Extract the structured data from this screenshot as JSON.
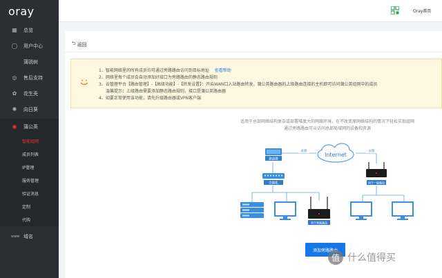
{
  "app": {
    "logo": "oray"
  },
  "topbar": {
    "home_link": "Oray首页"
  },
  "sidebar": {
    "items": [
      {
        "label": "总览",
        "icon": "grid-icon"
      },
      {
        "label": "用户中心",
        "icon": "user-icon"
      },
      {
        "label": "蒲锐树",
        "icon": ""
      },
      {
        "label": "售后支持",
        "icon": "support-icon"
      },
      {
        "label": "花生壳",
        "icon": "peanut-icon"
      },
      {
        "label": "向日葵",
        "icon": "sunflower-icon"
      },
      {
        "label": "蒲公英",
        "icon": "dandelion-icon"
      }
    ],
    "sub_items": [
      {
        "label": "智能组网",
        "active": true
      },
      {
        "label": "成员列表"
      },
      {
        "label": "IP管理"
      },
      {
        "label": "服务管理"
      },
      {
        "label": "验证消息"
      },
      {
        "label": "定制"
      },
      {
        "label": "代购"
      }
    ],
    "domain_item": {
      "label": "域名",
      "icon": "www-icon"
    }
  },
  "main": {
    "back_label": "返回",
    "tips": [
      {
        "text": "1、智能网络里的所有成员均可通过旁路路由访问到目标地址",
        "link": "查看帮助"
      },
      {
        "text": "2、网络里每个成员会自动添加好接口为旁路路由的静态路由规则",
        "link": ""
      },
      {
        "text": "3、云管理平台【路由管理】-【高级功能】-【转发设置】：开启WAN口入站路由转发，蒲公英路由器的上级路由连接的主机即可访问蒲公英组网中的成员",
        "link": ""
      },
      {
        "text": "温馨提示：上级路由需要添加静态路由规则，接口是蒲公英路由器",
        "link": ""
      },
      {
        "text": "4、如要正常使用该功能，请先升级路由器或VPN客户端",
        "link": ""
      }
    ],
    "intro_line1": "适用于总部网络结构复杂或部署难度大的网络环境，在不改变原网络结构的情况下轻松实现组网",
    "intro_line2": "通过旁路路由可以访问总部局域网的设备和资源",
    "diagram": {
      "router_label": "路由器",
      "switch_label": "交换机",
      "internet_label": "Internet",
      "hq_label": "总部",
      "branch_label": "分部",
      "bypass_label": "用于旁路路由",
      "gateway_label": "用于一级路由"
    },
    "add_button": "添加旁路路由"
  },
  "watermark": {
    "badge": "值",
    "text": "什么值得买"
  },
  "colors": {
    "sidebar": "#2b2e33",
    "accent": "#e33",
    "primary": "#1677e8",
    "tip_bg": "#fff8e0"
  }
}
